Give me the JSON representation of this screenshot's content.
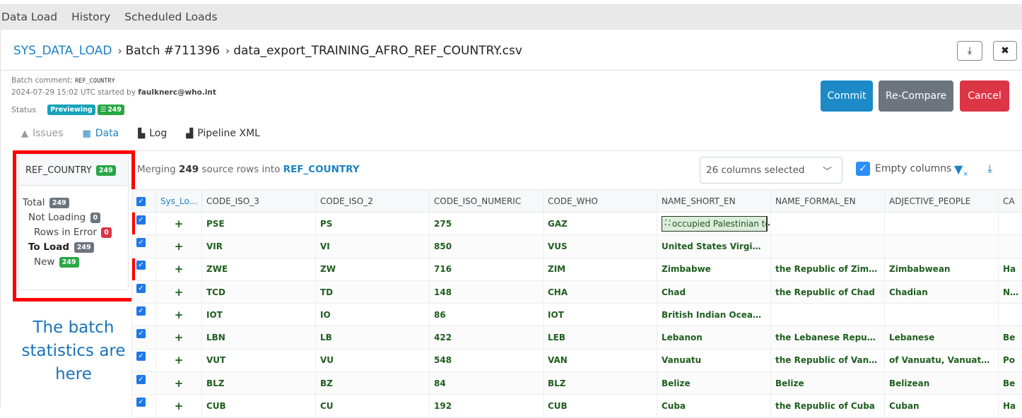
{
  "topnav": {
    "items": [
      "Data Load",
      "History",
      "Scheduled Loads"
    ]
  },
  "breadcrumb": {
    "root": "SYS_DATA_LOAD",
    "batch": "Batch #711396",
    "file": "data_export_TRAINING_AFRO_REF_COUNTRY.csv",
    "separator": "›"
  },
  "header_actions": {
    "download_icon": "download-icon",
    "close_icon": "close-icon",
    "download_glyph": "⤓",
    "close_glyph": "✖"
  },
  "meta": {
    "batch_comment_label": "Batch comment:",
    "batch_comment_value": "REF_COUNTRY",
    "started_line_prefix": "2024-07-29 15:02 UTC started by",
    "started_by": "faulknerc@who.int",
    "status_label": "Status",
    "status_badge": "Previewing",
    "rows_badge": "249"
  },
  "actions": {
    "commit": "Commit",
    "recompare": "Re-Compare",
    "cancel": "Cancel"
  },
  "colors": {
    "commit": "#1b8ac6",
    "recompare": "#6c757d",
    "cancel": "#dc3545",
    "accent": "#1b82c4",
    "cell_text": "#1f5e1f"
  },
  "tabs": [
    {
      "label": "Issues",
      "icon": "warning-icon",
      "state": "muted"
    },
    {
      "label": "Data",
      "icon": "table-icon",
      "state": "active"
    },
    {
      "label": "Log",
      "icon": "scroll-icon",
      "state": "normal"
    },
    {
      "label": "Pipeline XML",
      "icon": "file-code-icon",
      "state": "normal"
    }
  ],
  "stats": {
    "table_name": "REF_COUNTRY",
    "table_count": "249",
    "total_label": "Total",
    "total": "249",
    "not_loading_label": "Not Loading",
    "not_loading": "0",
    "rows_in_error_label": "Rows in Error",
    "rows_in_error": "0",
    "to_load_label": "To Load",
    "to_load": "249",
    "new_label": "New",
    "new": "249"
  },
  "annotation": "The batch statistics are here",
  "merge": {
    "prefix": "Merging",
    "count": "249",
    "middle": "source rows into",
    "table": "REF_COUNTRY"
  },
  "column_select": {
    "value": "26 columns selected"
  },
  "empty_columns": {
    "label": "Empty columns",
    "checked": true
  },
  "grid": {
    "columns": [
      "",
      "Sys_Lo...",
      "CODE_ISO_3",
      "CODE_ISO_2",
      "CODE_ISO_NUMERIC",
      "CODE_WHO",
      "NAME_SHORT_EN",
      "NAME_FORMAL_EN",
      "ADJECTIVE_PEOPLE",
      "CA"
    ],
    "rows": [
      {
        "op": "+",
        "iso3": "PSE",
        "iso2": "PS",
        "num": "275",
        "who": "GAZ",
        "short": "occupied Palestinian te",
        "formal": "",
        "adj": "",
        "ca": ""
      },
      {
        "op": "+",
        "iso3": "VIR",
        "iso2": "VI",
        "num": "850",
        "who": "VUS",
        "short": "United States Virgin Isla...",
        "formal": "",
        "adj": "",
        "ca": ""
      },
      {
        "op": "+",
        "iso3": "ZWE",
        "iso2": "ZW",
        "num": "716",
        "who": "ZIM",
        "short": "Zimbabwe",
        "formal": "the Republic of Zimbab...",
        "adj": "Zimbabwean",
        "ca": "Ha"
      },
      {
        "op": "+",
        "iso3": "TCD",
        "iso2": "TD",
        "num": "148",
        "who": "CHA",
        "short": "Chad",
        "formal": "the Republic of Chad",
        "adj": "Chadian",
        "ca": "N'D"
      },
      {
        "op": "+",
        "iso3": "IOT",
        "iso2": "IO",
        "num": "86",
        "who": "IOT",
        "short": "British Indian Ocean Ter...",
        "formal": "",
        "adj": "",
        "ca": ""
      },
      {
        "op": "+",
        "iso3": "LBN",
        "iso2": "LB",
        "num": "422",
        "who": "LEB",
        "short": "Lebanon",
        "formal": "the Lebanese Republic",
        "adj": "Lebanese",
        "ca": "Be"
      },
      {
        "op": "+",
        "iso3": "VUT",
        "iso2": "VU",
        "num": "548",
        "who": "VAN",
        "short": "Vanuatu",
        "formal": "the Republic of Vanuatu",
        "adj": "of Vanuatu, Vanuatuan",
        "ca": "Po"
      },
      {
        "op": "+",
        "iso3": "BLZ",
        "iso2": "BZ",
        "num": "84",
        "who": "BLZ",
        "short": "Belize",
        "formal": "Belize",
        "adj": "Belizean",
        "ca": "Be"
      },
      {
        "op": "+",
        "iso3": "CUB",
        "iso2": "CU",
        "num": "192",
        "who": "CUB",
        "short": "Cuba",
        "formal": "the Republic of Cuba",
        "adj": "Cuban",
        "ca": "Ha"
      }
    ]
  }
}
